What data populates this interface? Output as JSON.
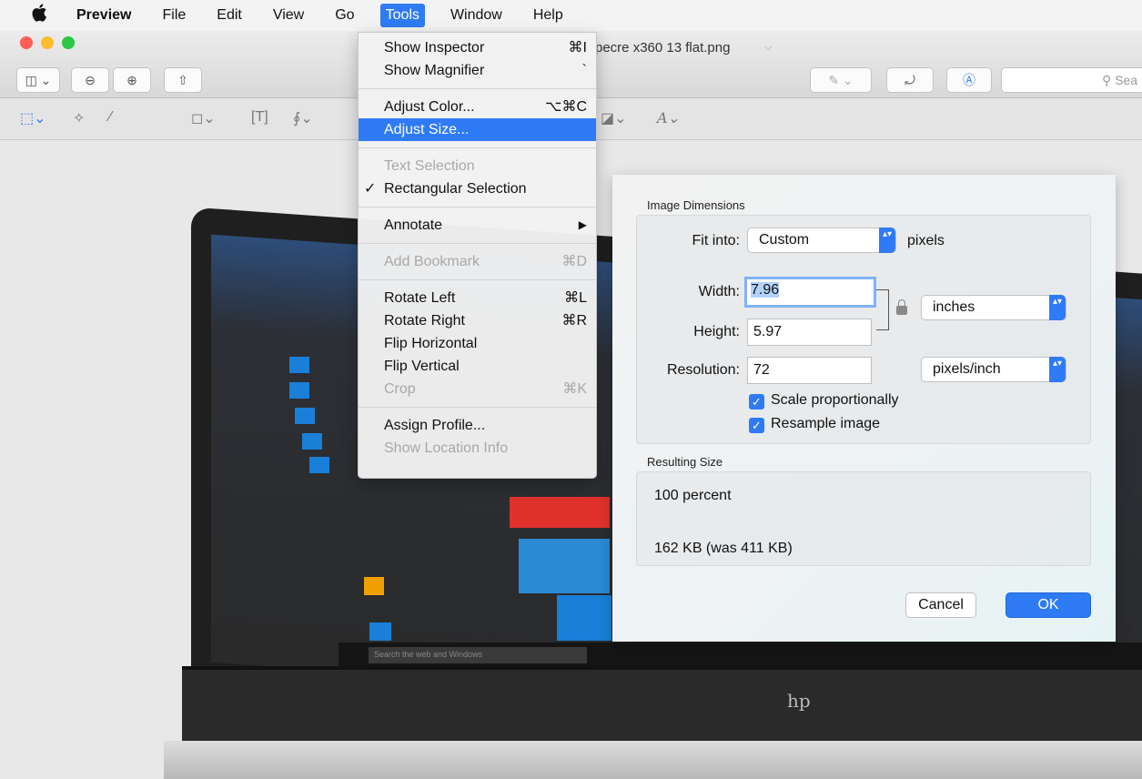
{
  "menubar": {
    "apple_icon": "apple-logo",
    "items": [
      "Preview",
      "File",
      "Edit",
      "View",
      "Go",
      "Tools",
      "Window",
      "Help"
    ],
    "active": "Tools"
  },
  "window": {
    "title": "pecre x360 13 flat.png",
    "search_placeholder": "Sea"
  },
  "tools_menu": {
    "show_inspector": "Show Inspector",
    "show_inspector_sc": "⌘I",
    "show_magnifier": "Show Magnifier",
    "show_magnifier_sc": "`",
    "adjust_color": "Adjust Color...",
    "adjust_color_sc": "⌥⌘C",
    "adjust_size": "Adjust Size...",
    "text_selection": "Text Selection",
    "rect_selection": "Rectangular Selection",
    "checkmark": "✓",
    "annotate": "Annotate",
    "annotate_arrow": "▶",
    "add_bookmark": "Add Bookmark",
    "add_bookmark_sc": "⌘D",
    "rotate_left": "Rotate Left",
    "rotate_left_sc": "⌘L",
    "rotate_right": "Rotate Right",
    "rotate_right_sc": "⌘R",
    "flip_horizontal": "Flip Horizontal",
    "flip_vertical": "Flip Vertical",
    "crop": "Crop",
    "crop_sc": "⌘K",
    "assign_profile": "Assign Profile...",
    "show_location": "Show Location Info"
  },
  "dialog": {
    "image_dimensions_title": "Image Dimensions",
    "fit_into_label": "Fit into:",
    "fit_into_value": "Custom",
    "fit_into_unit": "pixels",
    "width_label": "Width:",
    "width_value": "7.96",
    "height_label": "Height:",
    "height_value": "5.97",
    "size_unit": "inches",
    "resolution_label": "Resolution:",
    "resolution_value": "72",
    "resolution_unit": "pixels/inch",
    "scale_label": "Scale proportionally",
    "scale_checked": true,
    "resample_label": "Resample image",
    "resample_checked": true,
    "resulting_title": "Resulting Size",
    "percent": "100 percent",
    "filesize": "162 KB (was 411 KB)",
    "cancel": "Cancel",
    "ok": "OK",
    "checkmark": "✓",
    "popup_arrows": "▴▾"
  },
  "laptop": {
    "search_text": "Search the web and Windows",
    "logo": "hp"
  },
  "colors": {
    "accent": "#2f7bf6",
    "menubar": "#f3f3f3"
  }
}
